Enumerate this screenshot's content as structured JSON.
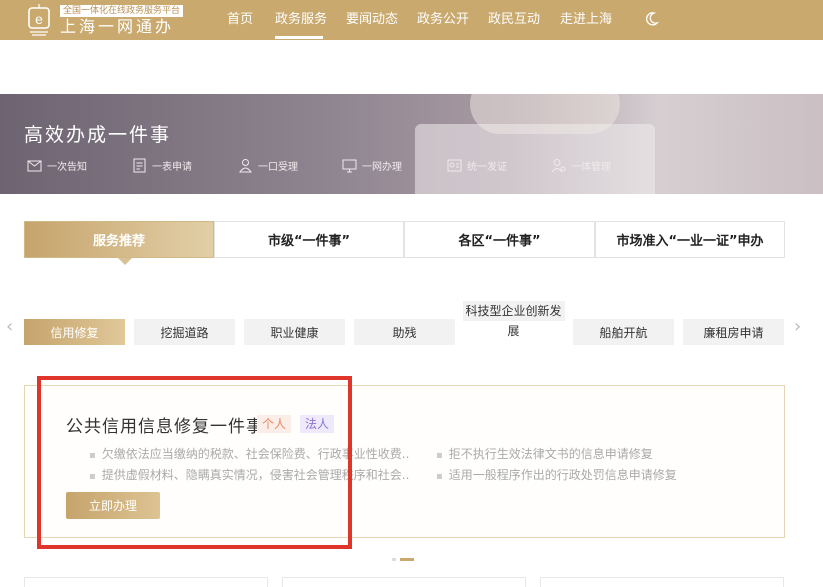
{
  "header": {
    "logo_tagline": "全国一体化在线政务服务平台",
    "logo_name": "上海一网通办",
    "nav": [
      {
        "label": "首页"
      },
      {
        "label": "政务服务"
      },
      {
        "label": "要闻动态"
      },
      {
        "label": "政务公开"
      },
      {
        "label": "政民互动"
      },
      {
        "label": "走进上海"
      }
    ],
    "active_nav": "政务服务",
    "extra_icon": "elder-mode-icon"
  },
  "banner": {
    "title": "高效办成一件事",
    "features": [
      {
        "label": "一次告知",
        "icon": "notice-icon"
      },
      {
        "label": "一表申请",
        "icon": "form-icon"
      },
      {
        "label": "一口受理",
        "icon": "reception-icon"
      },
      {
        "label": "一网办理",
        "icon": "computer-icon"
      },
      {
        "label": "统一发证",
        "icon": "certificate-icon"
      },
      {
        "label": "一体管理",
        "icon": "management-icon"
      }
    ]
  },
  "categories": [
    {
      "label": "服务推荐",
      "active": true
    },
    {
      "label": "市级“一件事”",
      "active": false
    },
    {
      "label": "各区“一件事”",
      "active": false
    },
    {
      "label": "市场准入“一业一证”申办",
      "active": false
    }
  ],
  "services": [
    {
      "label": "信用修复",
      "active": true
    },
    {
      "label": "挖掘道路"
    },
    {
      "label": "职业健康"
    },
    {
      "label": "助残"
    },
    {
      "label_line1": "科技型企业创新发",
      "label_line2": "展"
    },
    {
      "label": "船舶开航"
    },
    {
      "label": "廉租房申请"
    }
  ],
  "detail": {
    "title": "公共信用信息修复一件事",
    "badges": [
      "个人",
      "法人"
    ],
    "items_left": [
      "欠缴依法应当缴纳的税款、社会保险费、行政事业性收费...",
      "提供虚假材料、隐瞒真实情况，侵害社会管理秩序和社会..."
    ],
    "items_right": [
      "拒不执行生效法律文书的信息申请修复",
      "适用一般程序作出的行政处罚信息申请修复"
    ],
    "apply_label": "立即办理"
  },
  "colors": {
    "brand_gold": "#c9a96e",
    "highlight_red": "#e0352b"
  }
}
